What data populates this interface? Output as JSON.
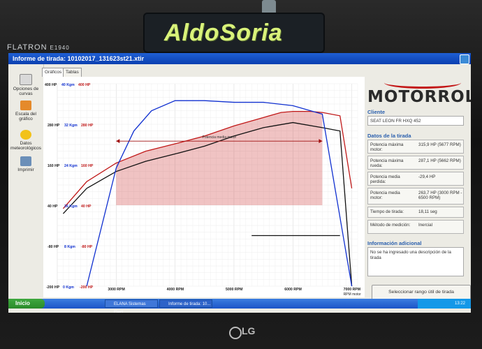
{
  "monitor": {
    "brand": "FLATRON",
    "model": "E1940",
    "maker": "LG",
    "sticker": "AldoSoria"
  },
  "window": {
    "title": "Informe de tirada: 10102017_131623st21.xtir"
  },
  "toolbar": {
    "items": [
      {
        "label": "Opciones de curvas"
      },
      {
        "label": "Escala del gráfico"
      },
      {
        "label": "Datos meteorológicos"
      },
      {
        "label": "Imprimir"
      }
    ]
  },
  "tabs": [
    {
      "label": "Gráficos"
    },
    {
      "label": "Tablas"
    }
  ],
  "chart_data": {
    "type": "line",
    "xlabel": "",
    "ylabel": "",
    "x_ticks": [
      "3000 RPM",
      "4000 RPM",
      "5000 RPM",
      "6000 RPM",
      "7000 RPM"
    ],
    "x_end_label": "RPM motor",
    "y_ticks": [
      {
        "hp": "400 HP",
        "kgm": "40 Kgm",
        "hp2": "400 HP"
      },
      {
        "hp": "280 HP",
        "kgm": "32 Kgm",
        "hp2": "280 HP"
      },
      {
        "hp": "160 HP",
        "kgm": "24 Kgm",
        "hp2": "160 HP"
      },
      {
        "hp": "40 HP",
        "kgm": "16 Kgm",
        "hp2": "40 HP"
      },
      {
        "hp": "-80 HP",
        "kgm": "8 Kgm",
        "hp2": "-80 HP"
      },
      {
        "hp": "-200 HP",
        "kgm": "0 Kgm",
        "hp2": "-200 HP"
      }
    ],
    "annotation": "Potencia media motor",
    "series": [
      {
        "color": "#c01818",
        "x": [
          2100,
          2500,
          3000,
          3500,
          4000,
          4500,
          5000,
          5500,
          5800,
          6000,
          6300,
          6500,
          6800,
          7000
        ],
        "y": [
          30,
          110,
          165,
          200,
          222,
          245,
          275,
          300,
          315,
          318,
          318,
          315,
          305,
          90
        ]
      },
      {
        "color": "#111111",
        "x": [
          2100,
          2500,
          3000,
          3500,
          4000,
          4500,
          5000,
          5500,
          6000,
          6500,
          6800,
          7000
        ],
        "y": [
          15,
          90,
          140,
          170,
          192,
          215,
          245,
          270,
          285,
          270,
          260,
          -200
        ]
      },
      {
        "color": "#1030d0",
        "x": [
          2500,
          3000,
          3300,
          3600,
          4000,
          4500,
          5000,
          5500,
          6000,
          6500,
          7000
        ],
        "y": [
          -200,
          150,
          260,
          320,
          350,
          350,
          345,
          345,
          335,
          310,
          -200
        ]
      },
      {
        "color": "#111111",
        "x": [
          5300,
          6000,
          6800
        ],
        "y": [
          -50,
          -50,
          -50
        ]
      }
    ],
    "shaded_band": {
      "x_start": 3000,
      "x_end": 6500,
      "y_low": 40
    },
    "xlim": [
      2000,
      7100
    ],
    "ylim": [
      -200,
      400
    ]
  },
  "brand_panel": {
    "logo": "MOTORROLL"
  },
  "cliente": {
    "title": "Cliente",
    "value": "SEAT LEON FR HXQ 452"
  },
  "datos": {
    "title": "Datos de la tirada",
    "rows": [
      {
        "label": "Potencia máxima motor:",
        "value": "315,9 HP (5677 RPM)"
      },
      {
        "label": "Potencia máxima rueda:",
        "value": "287,1 HP (5662 RPM)"
      },
      {
        "label": "Potencia media perdida:",
        "value": "-29,4 HP"
      },
      {
        "label": "Potencia media motor:",
        "value": "263,7 HP (3000 RPM - 6500 RPM)"
      },
      {
        "label": "Tiempo de tirada:",
        "value": "18,11 seg"
      },
      {
        "label": "Método de medición:",
        "value": "Inercial"
      }
    ]
  },
  "info": {
    "title": "Información adicional",
    "text": "No se ha ingresado una descripción de la tirada"
  },
  "select_button": {
    "label": "Seleccionar rango útil de tirada"
  },
  "taskbar": {
    "start": "Inicio",
    "tasks": [
      {
        "label": "ELANA Sistemas Elect..."
      },
      {
        "label": "Informe de tirada: 10..."
      }
    ],
    "clock": "13:22"
  },
  "colors": {
    "hp_axis": "#c01818",
    "kgm_axis": "#1030d0",
    "accent": "#2a5fae"
  }
}
